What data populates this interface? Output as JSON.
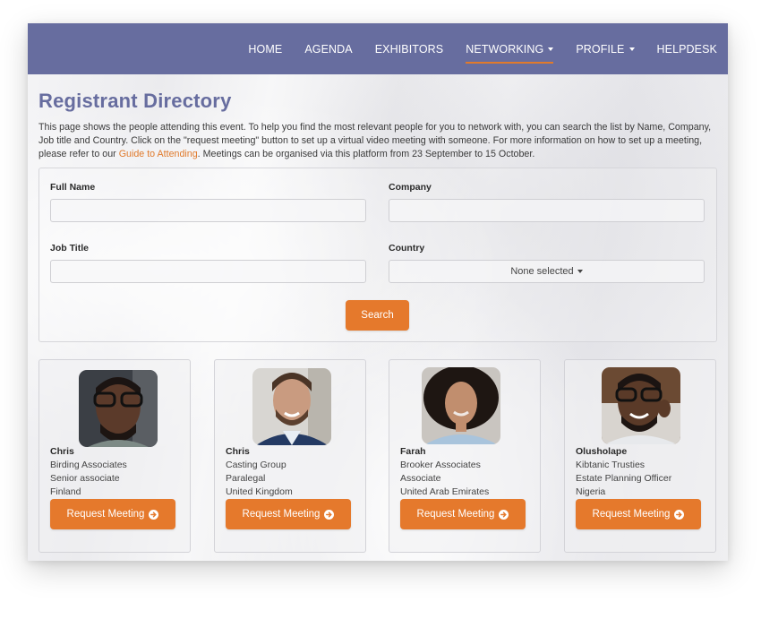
{
  "nav": {
    "items": [
      {
        "label": "HOME",
        "dropdown": false,
        "active": false
      },
      {
        "label": "AGENDA",
        "dropdown": false,
        "active": false
      },
      {
        "label": "EXHIBITORS",
        "dropdown": false,
        "active": false
      },
      {
        "label": "NETWORKING",
        "dropdown": true,
        "active": true
      },
      {
        "label": "PROFILE",
        "dropdown": true,
        "active": false
      },
      {
        "label": "HELPDESK",
        "dropdown": false,
        "active": false
      }
    ]
  },
  "page": {
    "title": "Registrant Directory",
    "intro_before_link": "This page shows the people attending this event. To help you find the most relevant people for you to network with, you can search the list by Name, Company, Job title and Country. Click on the \"request meeting\" button to set up a virtual video meeting with someone. For more information on how to set up a meeting, please refer to our ",
    "intro_link": "Guide to Attending",
    "intro_after_link": ". Meetings can be organised via this platform from 23 September to 15 October."
  },
  "filters": {
    "full_name": {
      "label": "Full Name",
      "value": ""
    },
    "company": {
      "label": "Company",
      "value": ""
    },
    "job_title": {
      "label": "Job Title",
      "value": ""
    },
    "country": {
      "label": "Country",
      "selected": "None selected"
    },
    "search_label": "Search"
  },
  "registrants": [
    {
      "name": "Chris",
      "company": "Birding Associates",
      "job_title": "Senior associate",
      "country": "Finland",
      "button_label": "Request Meeting",
      "photo": "avatar-man-glasses"
    },
    {
      "name": "Chris",
      "company": "Casting Group",
      "job_title": "Paralegal",
      "country": "United Kingdom",
      "button_label": "Request Meeting",
      "photo": "avatar-man-beard-suit"
    },
    {
      "name": "Farah",
      "company": "Brooker Associates",
      "job_title": "Associate",
      "country": "United Arab Emirates",
      "button_label": "Request Meeting",
      "photo": "avatar-woman-curly-hair"
    },
    {
      "name": "Olusholape",
      "company": "Kibtanic Trusties",
      "job_title": "Estate Planning Officer",
      "country": "Nigeria",
      "button_label": "Request Meeting",
      "photo": "avatar-man-headset"
    }
  ],
  "colors": {
    "navbar": "#676d9f",
    "title": "#676d9f",
    "accent": "#e5792c",
    "link": "#e07a2c"
  }
}
